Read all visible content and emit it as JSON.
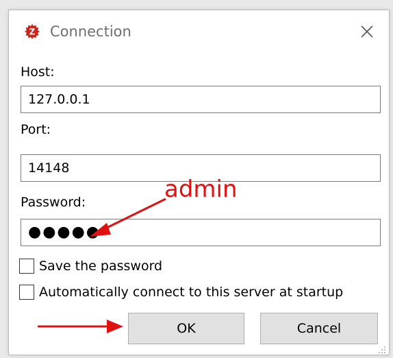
{
  "window": {
    "title": "Connection",
    "app_icon": "filezilla-server-icon",
    "close_icon": "close-icon"
  },
  "form": {
    "host_label": "Host:",
    "host_value": "127.0.0.1",
    "port_label": "Port:",
    "port_value": "14148",
    "password_label": "Password:",
    "password_masked": "●●●●●",
    "save_password_label": "Save the password",
    "save_password_checked": false,
    "auto_connect_label": "Automatically connect to this server at startup",
    "auto_connect_checked": false
  },
  "buttons": {
    "ok_label": "OK",
    "cancel_label": "Cancel"
  },
  "annotation": {
    "text": "admin",
    "color": "#e01010"
  },
  "colors": {
    "app_icon_red": "#c8251c",
    "button_bg": "#e1e1e1",
    "field_border": "#7a7a7a"
  }
}
